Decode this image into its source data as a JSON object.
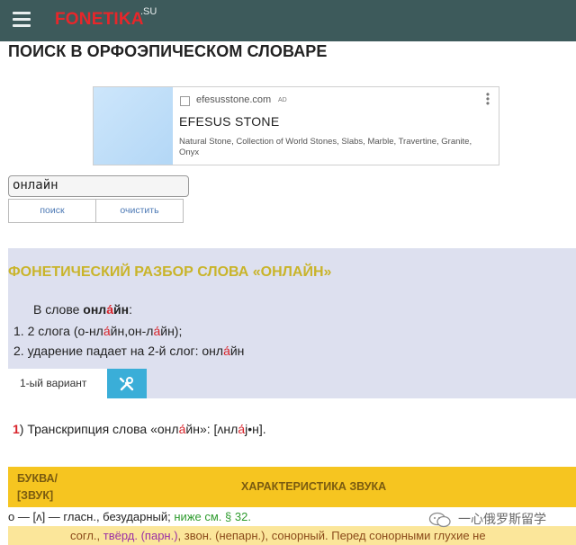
{
  "header": {
    "logo": "FONETIKA",
    "logo_suffix": ".SU",
    "menu_icon": "hamburger-icon"
  },
  "page_title": "ПОИСК В ОРФОЭПИЧЕСКОМ СЛОВАРЕ",
  "ad": {
    "domain": "efesusstone.com",
    "badge": "AD",
    "title": "EFESUS STONE",
    "description": "Natural Stone, Collection of World Stones, Slabs, Marble, Travertine, Granite, Onyx"
  },
  "search": {
    "value": "онлайн",
    "search_label": "поиск",
    "clear_label": "очистить"
  },
  "analysis": {
    "title": "ФОНЕТИЧЕСКИЙ РАЗБОР СЛОВА «ОНЛАЙН»",
    "word_prefix": "В слове ",
    "word_start": "онл",
    "word_stress": "а́",
    "word_end": "йн",
    "word_suffix": ":",
    "line1_num": "1.",
    "line1_a": " 2 слога (о-нл",
    "line1_s1": "а́",
    "line1_b": "йн,он-л",
    "line1_s2": "а́",
    "line1_c": "йн);",
    "line2_num": "2.",
    "line2_a": " ударение падает на 2-й слог: онл",
    "line2_s": "а́",
    "line2_b": "йн",
    "variant_tab": "1-ый вариант",
    "tools_icon": "tools-icon"
  },
  "transcription": {
    "num": "1",
    "text_a": ") Транскрипция слова «онл",
    "stress": "а́",
    "text_b": "йн»: [ʌнл",
    "stress2": "а́",
    "text_c": "j•н]."
  },
  "table": {
    "col_letter": "БУКВА/",
    "col_sound": "[ЗВУК]",
    "col_desc": "ХАРАКТЕРИСТИКА ЗВУКА",
    "row1_a": "о — [ʌ] — гласн., безударный; ",
    "row1_link": "ниже см. § 32.",
    "row2_a": "согл., ",
    "row2_purple": "твёрд. (парн.)",
    "row2_b": ", звон. (непарн.), сонорный. Перед сонорными глухие не"
  },
  "watermark": "一心俄罗斯留学",
  "colors": {
    "header_bg": "#3d5a5b",
    "logo": "#e8262a",
    "panel_bg": "#dde0ef",
    "panel_title": "#c9b42a",
    "table_head": "#f6c520",
    "stress": "#d8232a",
    "link_blue": "#4b78b4",
    "tool_blue": "#3aaed8"
  }
}
